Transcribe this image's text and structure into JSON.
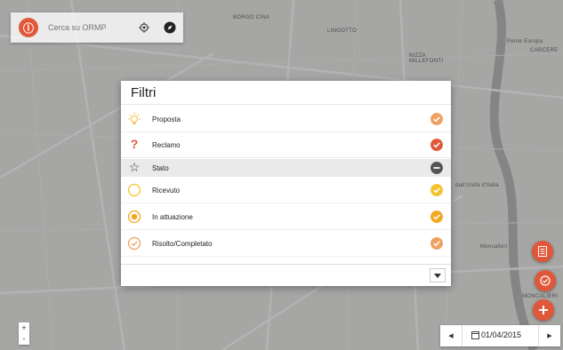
{
  "search": {
    "placeholder": "Cerca su ORMP"
  },
  "map": {
    "labels": [
      "BORGO CINA",
      "LINGOTTO",
      "NIZZA MILLEFONTI",
      "Ponte Europa",
      "CARCERE",
      "dall'Unità d'Italia",
      "Moncalieri",
      "MONCALIERI"
    ]
  },
  "modal": {
    "title": "Filtri",
    "items": [
      {
        "label": "Proposta",
        "icon": "lightbulb-icon",
        "check_color": "#f0a060"
      },
      {
        "label": "Reclamo",
        "icon": "question-icon",
        "check_color": "#e0573a"
      },
      {
        "label": "Stato",
        "icon": "star-icon",
        "check_color": "#555555"
      },
      {
        "label": "Ricevuto",
        "icon": "circle-outline-icon",
        "check_color": "#f4c430"
      },
      {
        "label": "In attuazione",
        "icon": "circle-dot-icon",
        "check_color": "#f4a820"
      },
      {
        "label": "Risolto/Completato",
        "icon": "check-circle-icon",
        "check_color": "#f0a060"
      }
    ]
  },
  "zoom": {
    "in": "+",
    "out": "-"
  },
  "date": {
    "value": "01/04/2015"
  },
  "colors": {
    "accent": "#e0573a"
  }
}
